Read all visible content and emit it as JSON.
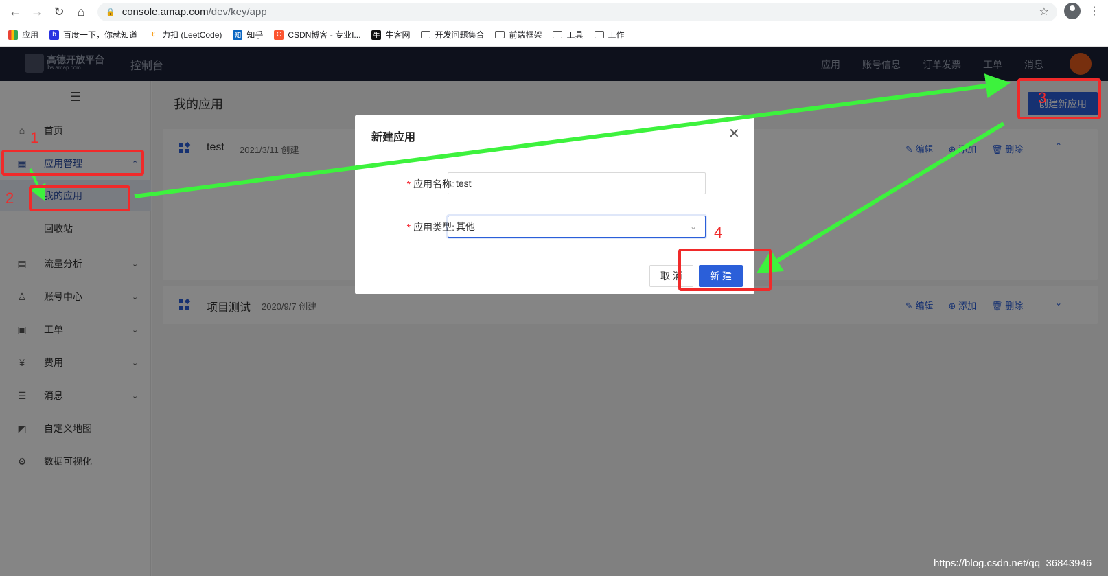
{
  "browser": {
    "url_host": "console.amap.com",
    "url_path": "/dev/key/app",
    "bookmarks": [
      {
        "label": "应用",
        "icon": "apps-grid-icon"
      },
      {
        "label": "百度一下，你就知道",
        "icon": "baidu-icon"
      },
      {
        "label": "力扣 (LeetCode)",
        "icon": "leetcode-icon"
      },
      {
        "label": "知乎",
        "icon": "zhihu-icon"
      },
      {
        "label": "CSDN博客 - 专业I...",
        "icon": "csdn-icon"
      },
      {
        "label": "牛客网",
        "icon": "nowcoder-icon"
      },
      {
        "label": "开发问题集合",
        "icon": "folder-icon"
      },
      {
        "label": "前端框架",
        "icon": "folder-icon"
      },
      {
        "label": "工具",
        "icon": "folder-icon"
      },
      {
        "label": "工作",
        "icon": "folder-icon"
      }
    ]
  },
  "header": {
    "logo_text": "高德开放平台",
    "logo_sub": "lbs.amap.com",
    "console_title": "控制台",
    "nav": [
      "应用",
      "账号信息",
      "订单发票",
      "工单",
      "消息"
    ]
  },
  "sidebar": {
    "items": [
      {
        "label": "首页",
        "icon": "home-icon"
      },
      {
        "label": "应用管理",
        "icon": "app-grid-icon"
      },
      {
        "label": "我的应用"
      },
      {
        "label": "回收站"
      },
      {
        "label": "流量分析",
        "icon": "chart-icon"
      },
      {
        "label": "账号中心",
        "icon": "user-icon"
      },
      {
        "label": "工单",
        "icon": "ticket-icon"
      },
      {
        "label": "费用",
        "icon": "fee-icon"
      },
      {
        "label": "消息",
        "icon": "message-icon"
      },
      {
        "label": "自定义地图",
        "icon": "map-icon"
      },
      {
        "label": "数据可视化",
        "icon": "visualization-icon"
      }
    ]
  },
  "main": {
    "title": "我的应用",
    "create_button": "创建新应用",
    "apps": [
      {
        "name": "test",
        "date": "2021/3/11 创建"
      },
      {
        "name": "项目测试",
        "date": "2020/9/7 创建"
      }
    ],
    "actions": {
      "edit": "编辑",
      "add": "添加",
      "delete": "删除"
    }
  },
  "modal": {
    "title": "新建应用",
    "name_label": "应用名称:",
    "name_value": "test",
    "type_label": "应用类型:",
    "type_value": "其他",
    "cancel": "取 消",
    "ok": "新 建"
  },
  "annotations": [
    "1",
    "2",
    "3",
    "4"
  ],
  "watermark": "https://blog.csdn.net/qq_36843946",
  "colors": {
    "accent": "#2b5fd9",
    "header_bg": "#1c2236",
    "annotation_red": "#f02a2a",
    "arrow_green": "#3df23d"
  }
}
